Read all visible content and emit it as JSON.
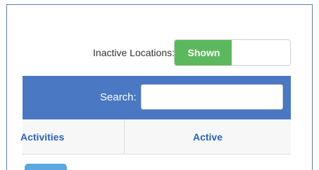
{
  "filters": {
    "inactive_label": "Inactive Locations:",
    "toggle_on_label": "Shown",
    "toggle_off_label": ""
  },
  "search": {
    "label": "Search:",
    "value": ""
  },
  "table": {
    "columns": [
      "Activities",
      "Active"
    ],
    "first_column_visible_text": "Activities"
  },
  "colors": {
    "accent": "#4a78c2",
    "toggle_on": "#5cb85c",
    "header_text": "#2a63b8"
  }
}
